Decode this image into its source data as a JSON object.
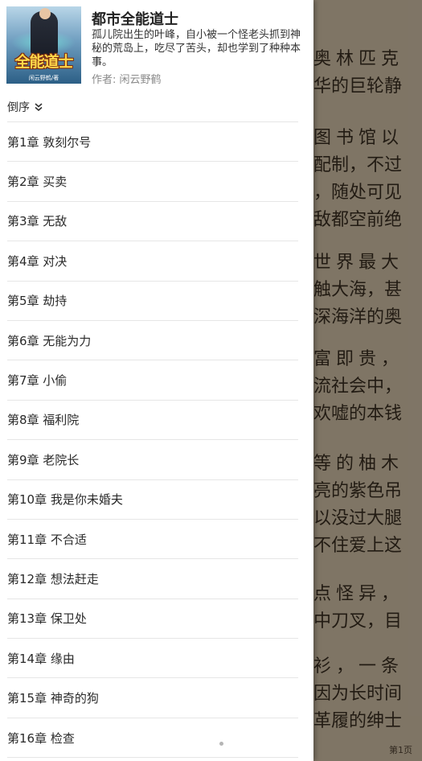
{
  "book": {
    "title": "都市全能道士",
    "description": "孤儿院出生的叶峰，自小被一个怪老头抓到神秘的荒岛上，吃尽了苦头，却也学到了种种本事。",
    "author_label": "作者: 闲云野鹤",
    "cover_title": "全能道士",
    "cover_author": "闲云野鹤/著"
  },
  "sort": {
    "label": "倒序"
  },
  "chapters": [
    "第1章 敦刻尔号",
    "第2章 买卖",
    "第3章 无敌",
    "第4章 对决",
    "第5章 劫持",
    "第6章 无能为力",
    "第7章 小偷",
    "第8章 福利院",
    "第9章 老院长",
    "第10章 我是你未婚夫",
    "第11章 不合适",
    "第12章 想法赶走",
    "第13章 保卫处",
    "第14章 缘由",
    "第15章 神奇的狗",
    "第16章 检查"
  ],
  "reader": {
    "lines": [
      "奥林匹克",
      "华的巨轮静",
      "",
      "图书馆以",
      "配制，不过",
      "，随处可见",
      "敌都空前绝",
      "",
      "世界最大",
      "触大海，甚",
      "深海洋的奥",
      "",
      "富即贵，",
      "流社会中，",
      "欢嘘的本钱",
      "",
      "等的柚木",
      "亮的紫色吊",
      "以没过大腿",
      "不住爱上这",
      "",
      "点怪异，",
      "中刀叉，目",
      "",
      "衫，一条",
      "因为长时间",
      "革履的绅士"
    ],
    "page_number": "第1页"
  },
  "colors": {
    "drawer_bg": "#ffffff",
    "divider": "#e6e6e6",
    "reader_bg": "#e9dcc4"
  }
}
